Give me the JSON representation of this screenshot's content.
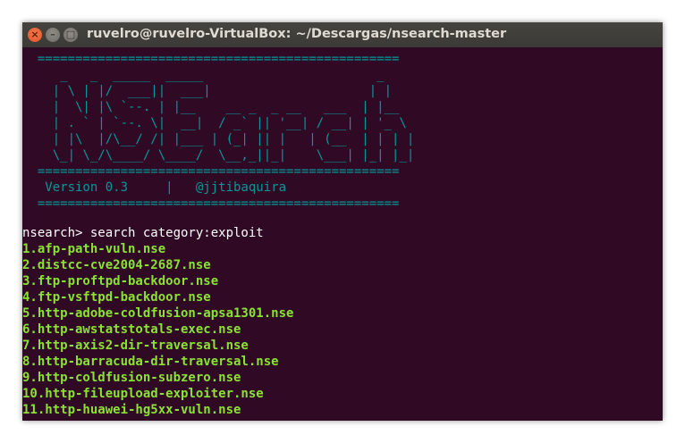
{
  "window": {
    "title": "ruvelro@ruvelro-VirtualBox: ~/Descargas/nsearch-master"
  },
  "banner": {
    "rule_top": "  ================================================",
    "art": [
      "     _   _  _____  _____                       _     ",
      "    | \\ | |/  ___||  ___|                     | |    ",
      "    |  \\| |\\ `--. | |__    __ _  _ __   ___  | |__  ",
      "    | . ` | `--. \\|  __|  / _` || '__| / __| | '_ \\ ",
      "    | |\\  |/\\__/ /| |___ | (_| || |   | (__  | | | |",
      "    \\_| \\_/\\____/ \\____/  \\__,_||_|    \\___| |_| |_|"
    ],
    "rule_mid": "  ================================================",
    "version_line": "   Version 0.3     |   @jjtibaquira",
    "rule_bottom": "  ================================================"
  },
  "prompt": {
    "text": "nsearch> search category:exploit"
  },
  "results": [
    "1.afp-path-vuln.nse",
    "2.distcc-cve2004-2687.nse",
    "3.ftp-proftpd-backdoor.nse",
    "4.ftp-vsftpd-backdoor.nse",
    "5.http-adobe-coldfusion-apsa1301.nse",
    "6.http-awstatstotals-exec.nse",
    "7.http-axis2-dir-traversal.nse",
    "8.http-barracuda-dir-traversal.nse",
    "9.http-coldfusion-subzero.nse",
    "10.http-fileupload-exploiter.nse",
    "11.http-huawei-hg5xx-vuln.nse"
  ],
  "colors": {
    "background": "#300a24",
    "banner": "#06989a",
    "prompt": "#ffffff",
    "results": "#8ae234"
  }
}
